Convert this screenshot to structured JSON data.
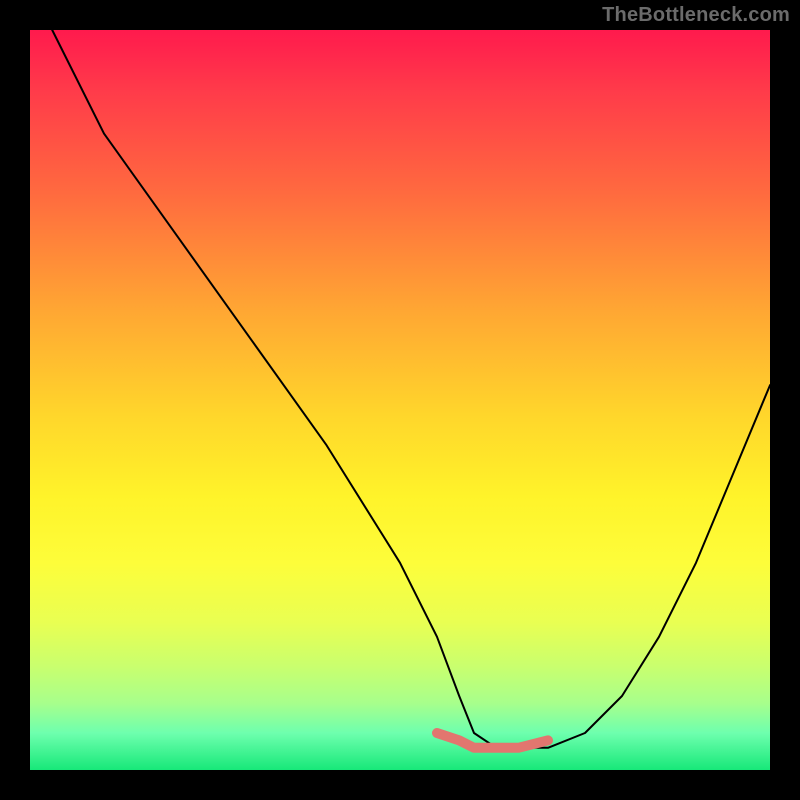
{
  "watermark": "TheBottleneck.com",
  "colors": {
    "frame": "#000000",
    "gradient_top": "#ff1a4d",
    "gradient_mid": "#fff32a",
    "gradient_bottom": "#17e879",
    "curve": "#000000",
    "bottom_marker": "#e2766f"
  },
  "chart_data": {
    "type": "line",
    "title": "",
    "xlabel": "",
    "ylabel": "",
    "xlim": [
      0,
      100
    ],
    "ylim": [
      0,
      100
    ],
    "grid": false,
    "legend": false,
    "series": [
      {
        "name": "bottleneck-curve",
        "x": [
          3,
          10,
          20,
          30,
          40,
          50,
          55,
          58,
          60,
          63,
          66,
          70,
          75,
          80,
          85,
          90,
          95,
          100
        ],
        "values": [
          100,
          86,
          72,
          58,
          44,
          28,
          18,
          10,
          5,
          3,
          3,
          3,
          5,
          10,
          18,
          28,
          40,
          52
        ]
      }
    ],
    "annotations": [
      {
        "name": "bottom-highlight",
        "type": "stroke",
        "x": [
          55,
          58,
          60,
          63,
          66,
          70
        ],
        "values": [
          5,
          4,
          3,
          3,
          3,
          4
        ]
      }
    ]
  }
}
